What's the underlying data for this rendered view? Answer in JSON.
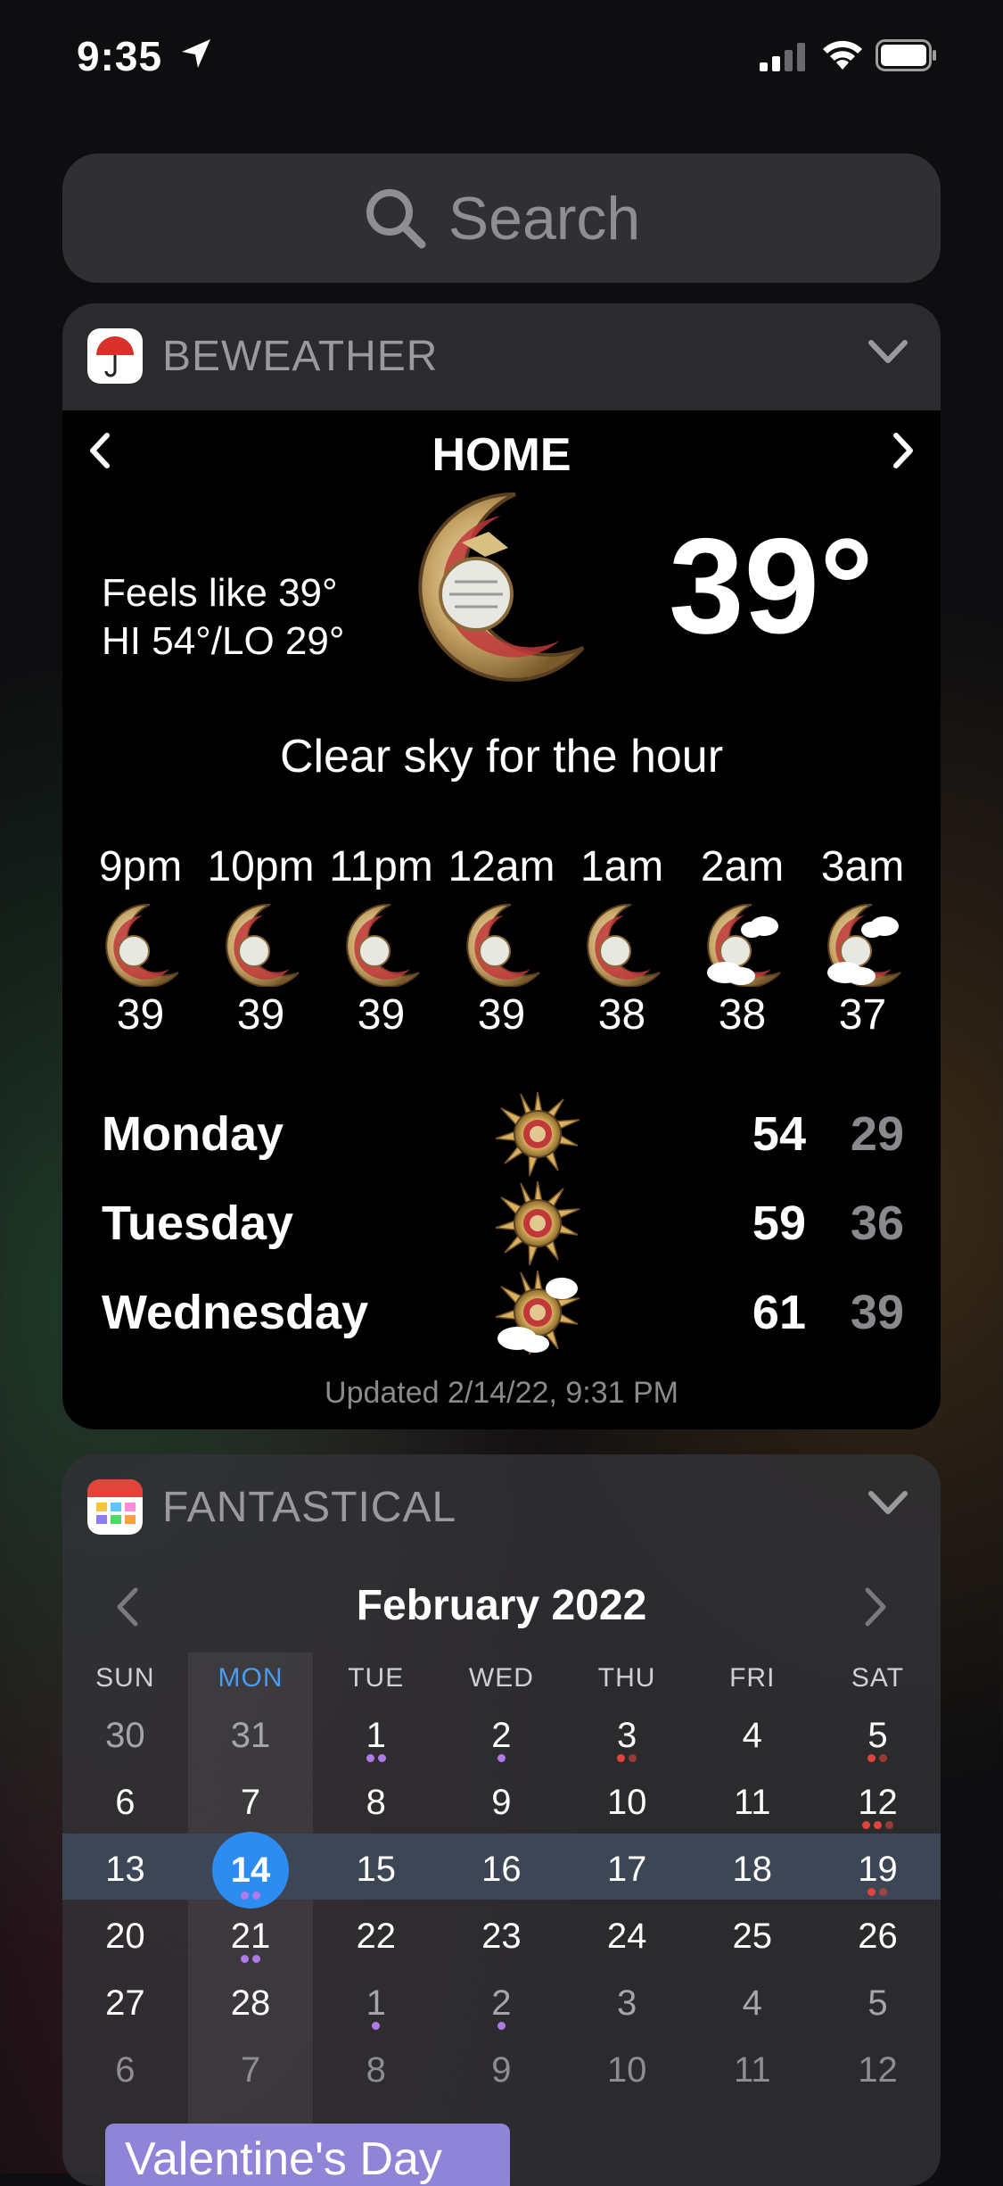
{
  "status_bar": {
    "time": "9:35"
  },
  "search": {
    "placeholder": "Search"
  },
  "beweather": {
    "app_name": "BEWEATHER",
    "location": "HOME",
    "feels_like": "Feels like 39°",
    "hi_lo": "HI 54°/LO 29°",
    "current_temp": "39°",
    "summary": "Clear sky for the hour",
    "hourly": [
      {
        "time": "9pm",
        "temp": "39",
        "icon": "moon-clear-icon"
      },
      {
        "time": "10pm",
        "temp": "39",
        "icon": "moon-clear-icon"
      },
      {
        "time": "11pm",
        "temp": "39",
        "icon": "moon-clear-icon"
      },
      {
        "time": "12am",
        "temp": "39",
        "icon": "moon-clear-icon"
      },
      {
        "time": "1am",
        "temp": "38",
        "icon": "moon-clear-icon"
      },
      {
        "time": "2am",
        "temp": "38",
        "icon": "moon-cloudy-icon"
      },
      {
        "time": "3am",
        "temp": "37",
        "icon": "moon-cloudy-icon"
      }
    ],
    "daily": [
      {
        "day": "Monday",
        "hi": "54",
        "lo": "29",
        "icon": "sun-clear-icon"
      },
      {
        "day": "Tuesday",
        "hi": "59",
        "lo": "36",
        "icon": "sun-clear-icon"
      },
      {
        "day": "Wednesday",
        "hi": "61",
        "lo": "39",
        "icon": "sun-cloudy-icon"
      }
    ],
    "updated": "Updated 2/14/22, 9:31 PM"
  },
  "fantastical": {
    "app_name": "FANTASTICAL",
    "month": "February 2022",
    "weekdays": [
      "SUN",
      "MON",
      "TUE",
      "WED",
      "THU",
      "FRI",
      "SAT"
    ],
    "weeks": [
      [
        "30",
        "31",
        "1",
        "2",
        "3",
        "4",
        "5"
      ],
      [
        "6",
        "7",
        "8",
        "9",
        "10",
        "11",
        "12"
      ],
      [
        "13",
        "14",
        "15",
        "16",
        "17",
        "18",
        "19"
      ],
      [
        "20",
        "21",
        "22",
        "23",
        "24",
        "25",
        "26"
      ],
      [
        "27",
        "28",
        "1",
        "2",
        "3",
        "4",
        "5"
      ],
      [
        "6",
        "7",
        "8",
        "9",
        "10",
        "11",
        "12"
      ]
    ],
    "event": "Valentine's Day",
    "colors": {
      "today": "#2d8cf0",
      "event_purple": "#b07be8",
      "event_red": "#e0443a",
      "chip": "#8f84d8"
    }
  }
}
